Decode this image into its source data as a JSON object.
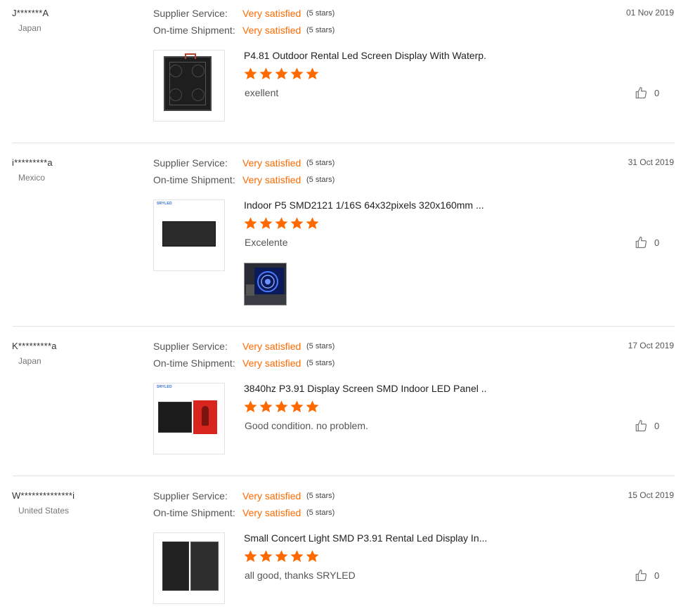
{
  "reviews": [
    {
      "buyer": "J*******A",
      "country": "Japan",
      "date": "01 Nov 2019",
      "ratings": [
        {
          "label": "Supplier Service:",
          "value": "Very satisfied",
          "stars": "(5 stars)"
        },
        {
          "label": "On-time Shipment:",
          "value": "Very satisfied",
          "stars": "(5 stars)"
        }
      ],
      "product": "P4.81 Outdoor Rental Led Screen Display With Waterp...",
      "product_stars": 5,
      "comment": "exellent",
      "likes": "0"
    },
    {
      "buyer": "i*********a",
      "country": "Mexico",
      "date": "31 Oct 2019",
      "ratings": [
        {
          "label": "Supplier Service:",
          "value": "Very satisfied",
          "stars": "(5 stars)"
        },
        {
          "label": "On-time Shipment:",
          "value": "Very satisfied",
          "stars": "(5 stars)"
        }
      ],
      "product": "Indoor P5 SMD2121 1/16S 64x32pixels 320x160mm ...",
      "product_stars": 5,
      "comment": "Excelente",
      "likes": "0",
      "brand": "SRYLED"
    },
    {
      "buyer": "K*********a",
      "country": "Japan",
      "date": "17 Oct 2019",
      "ratings": [
        {
          "label": "Supplier Service:",
          "value": "Very satisfied",
          "stars": "(5 stars)"
        },
        {
          "label": "On-time Shipment:",
          "value": "Very satisfied",
          "stars": "(5 stars)"
        }
      ],
      "product": "3840hz P3.91 Display Screen SMD Indoor LED Panel ...",
      "product_stars": 5,
      "comment": "Good condition. no problem.",
      "likes": "0",
      "brand": "SRYLED"
    },
    {
      "buyer": "W**************i",
      "country": "United States",
      "date": "15 Oct 2019",
      "ratings": [
        {
          "label": "Supplier Service:",
          "value": "Very satisfied",
          "stars": "(5 stars)"
        },
        {
          "label": "On-time Shipment:",
          "value": "Very satisfied",
          "stars": "(5 stars)"
        }
      ],
      "product": "Small Concert Light SMD P3.91 Rental Led Display In...",
      "product_stars": 5,
      "comment": "all good, thanks SRYLED",
      "likes": "0"
    }
  ],
  "colors": {
    "accent": "#ff6a00",
    "divider": "#e2e2e2"
  },
  "icons": {
    "star": "star-icon",
    "like": "thumbs-up-icon"
  }
}
